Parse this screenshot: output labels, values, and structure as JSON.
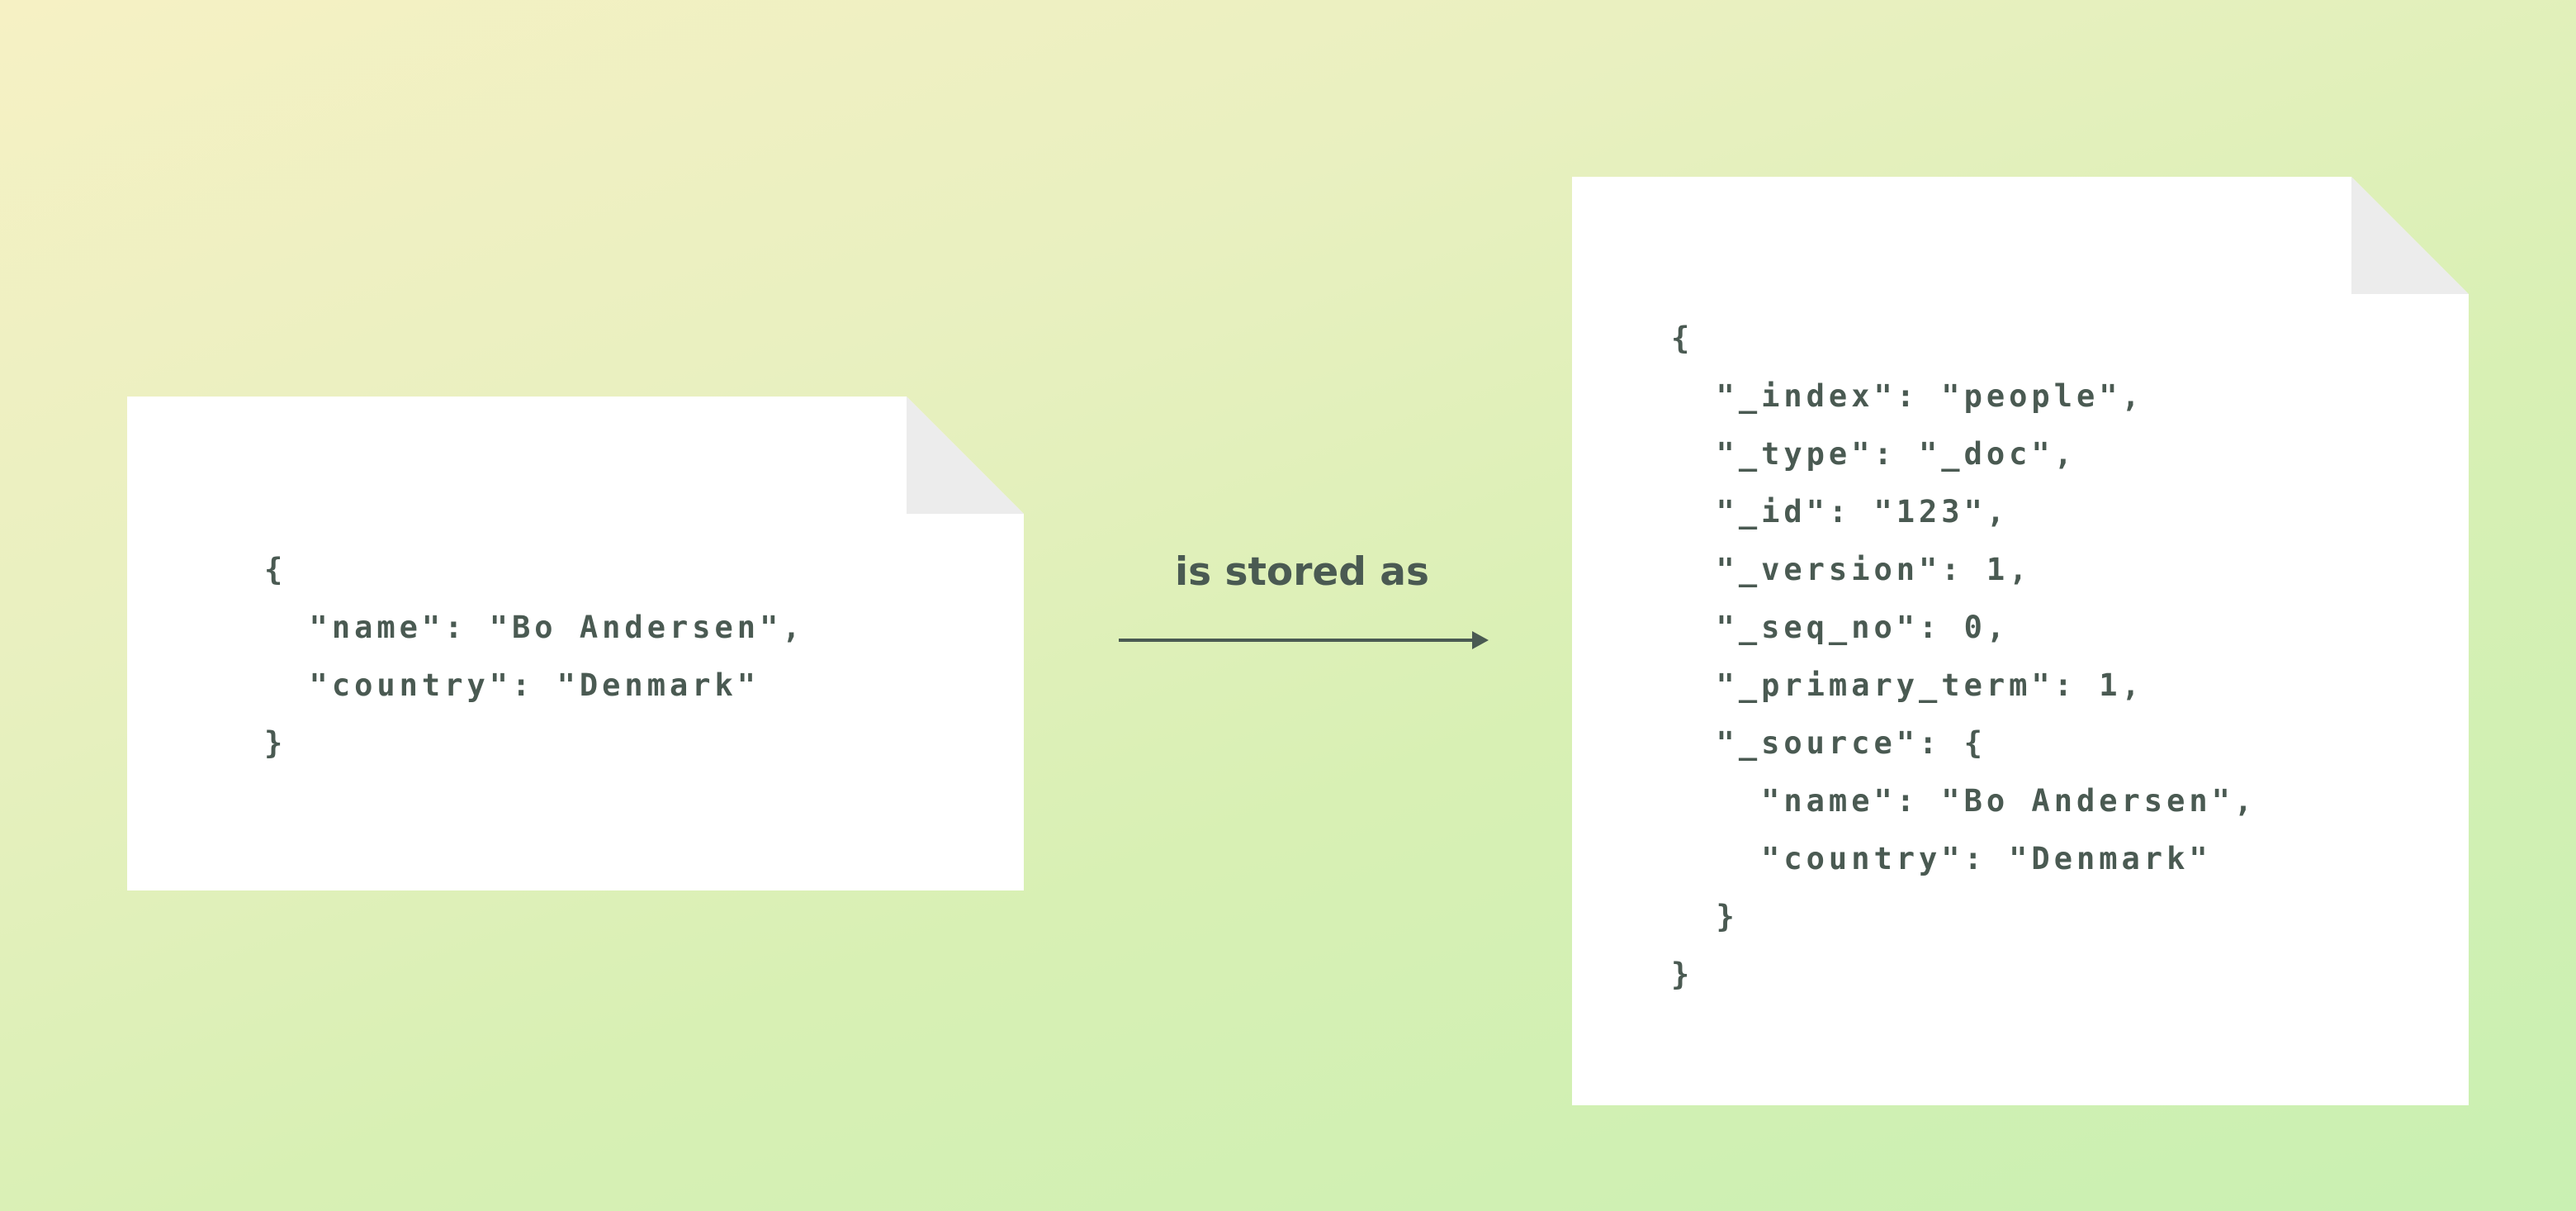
{
  "left_document": {
    "lines": [
      "{",
      "  \"name\": \"Bo Andersen\",",
      "  \"country\": \"Denmark\"",
      "}"
    ]
  },
  "arrow": {
    "label": "is stored as"
  },
  "right_document": {
    "lines": [
      "{",
      "  \"_index\": \"people\",",
      "  \"_type\": \"_doc\",",
      "  \"_id\": \"123\",",
      "  \"_version\": 1,",
      "  \"_seq_no\": 0,",
      "  \"_primary_term\": 1,",
      "  \"_source\": {",
      "    \"name\": \"Bo Andersen\",",
      "    \"country\": \"Denmark\"",
      "  }",
      "}"
    ]
  },
  "colors": {
    "text": "#4a5a52",
    "paper": "#ffffff",
    "fold": "#ececec"
  }
}
